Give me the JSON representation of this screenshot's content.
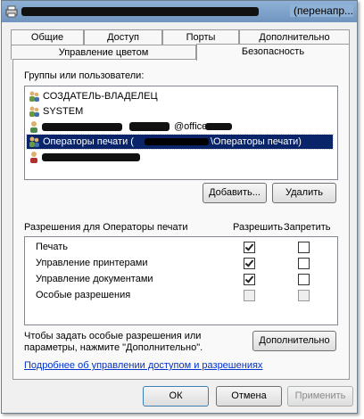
{
  "window": {
    "title_suffix": "(перенапр..."
  },
  "tabs_row1": [
    "Общие",
    "Доступ",
    "Порты",
    "Дополнительно"
  ],
  "tabs_row2": [
    "Управление цветом",
    "Безопасность"
  ],
  "groups_label": "Группы или пользователи:",
  "users": [
    {
      "name": "СОЗДАТЕЛЬ-ВЛАДЕЛЕЦ",
      "icon": "group-users-icon"
    },
    {
      "name": "SYSTEM",
      "icon": "group-users-icon"
    },
    {
      "name": "@office",
      "icon": "single-user-icon"
    },
    {
      "name": "Операторы печати (",
      "name_suffix": "\\Операторы печати)",
      "icon": "group-users-icon",
      "selected": true
    },
    {
      "name": "",
      "icon": "single-user-icon"
    }
  ],
  "buttons": {
    "add": "Добавить...",
    "remove": "Удалить",
    "advanced": "Дополнительно",
    "ok": "ОК",
    "cancel": "Отмена",
    "apply": "Применить"
  },
  "permissions": {
    "label": "Разрешения для Операторы печати",
    "allow_header": "Разрешить",
    "deny_header": "Запретить",
    "rows": [
      {
        "name": "Печать",
        "allow": true,
        "deny": false,
        "disabled": false
      },
      {
        "name": "Управление принтерами",
        "allow": true,
        "deny": false,
        "disabled": false
      },
      {
        "name": "Управление документами",
        "allow": true,
        "deny": false,
        "disabled": false
      },
      {
        "name": "Особые разрешения",
        "allow": false,
        "deny": false,
        "disabled": true
      }
    ]
  },
  "advanced_text": "Чтобы задать особые разрешения или параметры, нажмите \"Дополнительно\".",
  "help_link": "Подробнее об управлении доступом и разрешениях",
  "colors": {
    "selection": "#0a246a",
    "link": "#0033cc"
  }
}
